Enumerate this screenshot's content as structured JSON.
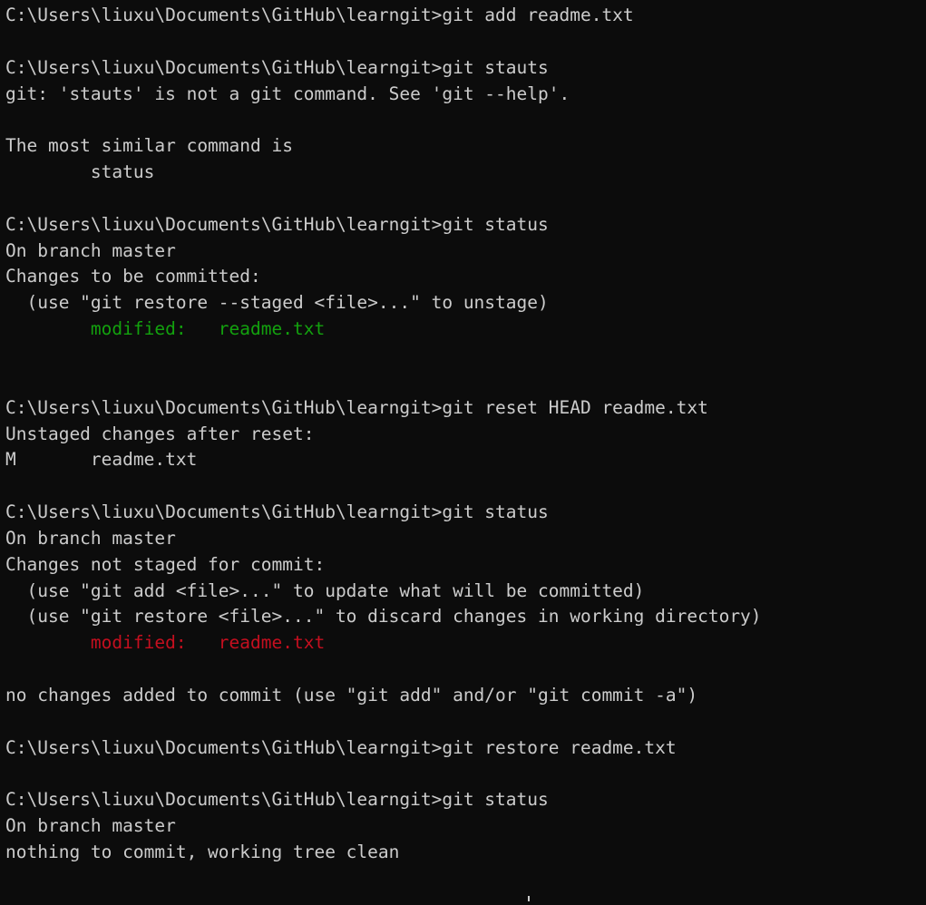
{
  "window": {
    "title": "Command Prompt",
    "shell": "cmd.exe",
    "prompt": "C:\\Users\\liuxu\\Documents\\GitHub\\learngit>"
  },
  "colors": {
    "background": "#0c0c0c",
    "foreground": "#cccccc",
    "green": "#13a10e",
    "red": "#c50f1f",
    "caret": "#cccccc"
  },
  "caret": {
    "visible": true,
    "column": 39,
    "row": 34
  },
  "terminal": {
    "lines": [
      {
        "segments": [
          {
            "text": "C:\\Users\\liuxu\\Documents\\GitHub\\learngit>git add readme.txt",
            "color": "default"
          }
        ]
      },
      {
        "segments": [
          {
            "text": "",
            "color": "default"
          }
        ]
      },
      {
        "segments": [
          {
            "text": "C:\\Users\\liuxu\\Documents\\GitHub\\learngit>git stauts",
            "color": "default"
          }
        ]
      },
      {
        "segments": [
          {
            "text": "git: 'stauts' is not a git command. See 'git --help'.",
            "color": "default"
          }
        ]
      },
      {
        "segments": [
          {
            "text": "",
            "color": "default"
          }
        ]
      },
      {
        "segments": [
          {
            "text": "The most similar command is",
            "color": "default"
          }
        ]
      },
      {
        "segments": [
          {
            "text": "        status",
            "color": "default"
          }
        ]
      },
      {
        "segments": [
          {
            "text": "",
            "color": "default"
          }
        ]
      },
      {
        "segments": [
          {
            "text": "C:\\Users\\liuxu\\Documents\\GitHub\\learngit>git status",
            "color": "default"
          }
        ]
      },
      {
        "segments": [
          {
            "text": "On branch master",
            "color": "default"
          }
        ]
      },
      {
        "segments": [
          {
            "text": "Changes to be committed:",
            "color": "default"
          }
        ]
      },
      {
        "segments": [
          {
            "text": "  (use \"git restore --staged <file>...\" to unstage)",
            "color": "default"
          }
        ]
      },
      {
        "segments": [
          {
            "text": "        modified:   readme.txt",
            "color": "green"
          }
        ]
      },
      {
        "segments": [
          {
            "text": "",
            "color": "default"
          }
        ]
      },
      {
        "segments": [
          {
            "text": "",
            "color": "default"
          }
        ]
      },
      {
        "segments": [
          {
            "text": "C:\\Users\\liuxu\\Documents\\GitHub\\learngit>git reset HEAD readme.txt",
            "color": "default"
          }
        ]
      },
      {
        "segments": [
          {
            "text": "Unstaged changes after reset:",
            "color": "default"
          }
        ]
      },
      {
        "segments": [
          {
            "text": "M       readme.txt",
            "color": "default"
          }
        ]
      },
      {
        "segments": [
          {
            "text": "",
            "color": "default"
          }
        ]
      },
      {
        "segments": [
          {
            "text": "C:\\Users\\liuxu\\Documents\\GitHub\\learngit>git status",
            "color": "default"
          }
        ]
      },
      {
        "segments": [
          {
            "text": "On branch master",
            "color": "default"
          }
        ]
      },
      {
        "segments": [
          {
            "text": "Changes not staged for commit:",
            "color": "default"
          }
        ]
      },
      {
        "segments": [
          {
            "text": "  (use \"git add <file>...\" to update what will be committed)",
            "color": "default"
          }
        ]
      },
      {
        "segments": [
          {
            "text": "  (use \"git restore <file>...\" to discard changes in working directory)",
            "color": "default"
          }
        ]
      },
      {
        "segments": [
          {
            "text": "        modified:   readme.txt",
            "color": "red"
          }
        ]
      },
      {
        "segments": [
          {
            "text": "",
            "color": "default"
          }
        ]
      },
      {
        "segments": [
          {
            "text": "no changes added to commit (use \"git add\" and/or \"git commit -a\")",
            "color": "default"
          }
        ]
      },
      {
        "segments": [
          {
            "text": "",
            "color": "default"
          }
        ]
      },
      {
        "segments": [
          {
            "text": "C:\\Users\\liuxu\\Documents\\GitHub\\learngit>git restore readme.txt",
            "color": "default"
          }
        ]
      },
      {
        "segments": [
          {
            "text": "",
            "color": "default"
          }
        ]
      },
      {
        "segments": [
          {
            "text": "C:\\Users\\liuxu\\Documents\\GitHub\\learngit>git status",
            "color": "default"
          }
        ]
      },
      {
        "segments": [
          {
            "text": "On branch master",
            "color": "default"
          }
        ]
      },
      {
        "segments": [
          {
            "text": "nothing to commit, working tree clean",
            "color": "default"
          }
        ]
      },
      {
        "segments": [
          {
            "text": "",
            "color": "default"
          }
        ]
      }
    ]
  }
}
